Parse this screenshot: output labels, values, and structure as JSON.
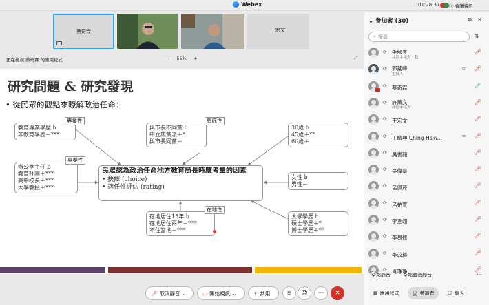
{
  "titlebar": {
    "app_name": "Webex",
    "time": "01:28:37",
    "meeting_info": "會議資訊"
  },
  "video_tiles": [
    {
      "name": "蔡奇霖",
      "type": "avatar"
    },
    {
      "name": "",
      "type": "video"
    },
    {
      "name": "",
      "type": "video"
    },
    {
      "name": "王宏文",
      "type": "avatar"
    }
  ],
  "share_bar": {
    "viewing": "正在檢視 蔡奇霖 的應用程式",
    "zoom_out": "-",
    "zoom": "55%",
    "zoom_in": "+"
  },
  "slide": {
    "title": "研究問題 & 研究發現",
    "bullet": "• 從民眾的觀點來瞭解政治任命：",
    "center": {
      "heading": "民眾認為政治任命地方教育局長時應考量的因素",
      "items": [
        "• 抉擇 (choice)",
        "• 適任性評估 (rating)"
      ]
    },
    "box_expertise": {
      "label": "專業性",
      "lines": [
        "教育專業學歷 b",
        "非教育學歷－***"
      ]
    },
    "box_experience": {
      "label": "專業性",
      "lines": [
        "辦公室主任 b",
        "教育社團＋***",
        "高中校長＋***",
        "大學教授＋***"
      ]
    },
    "box_partisan": {
      "label": "恩庇性",
      "lines": [
        "與市長不同黨 b",
        "中立無黨派＋*",
        "與市長同黨－"
      ]
    },
    "box_age": {
      "lines": [
        "30歲 b",
        "45歲＋**",
        "60歲＋"
      ]
    },
    "box_gender": {
      "lines": [
        "女性 b",
        "男性－"
      ]
    },
    "box_local": {
      "label": "在地性",
      "lines": [
        "在地居住15年 b",
        "在地居住兩年－***",
        "不住當地－***"
      ]
    },
    "box_degree": {
      "lines": [
        "大學學歷 b",
        "碩士學歷＋*",
        "博士學歷＋**"
      ]
    }
  },
  "stripe_colors": [
    "#5a3f68",
    "#7d2f2f",
    "#f2b705"
  ],
  "toolbar": {
    "mute": "取消靜音",
    "video": "開始視訊",
    "share": "共用"
  },
  "panel": {
    "title": "參加者 (30)",
    "search_placeholder": "搜尋",
    "participants": [
      {
        "name": "李郁岑",
        "role": "共同主持人・我",
        "mic": "muted"
      },
      {
        "name": "郭銘峰",
        "role": "主持人",
        "mic": "muted",
        "camera": true,
        "avatar": "photo"
      },
      {
        "name": "蔡奇霖",
        "role": "",
        "mic": "active",
        "presenter": true
      },
      {
        "name": "許薰文",
        "role": "共同主持人",
        "mic": "muted"
      },
      {
        "name": "王宏文",
        "role": "",
        "mic": "muted"
      },
      {
        "name": "王晴興 Ching-Hsin...",
        "role": "",
        "mic": "muted",
        "camera": true
      },
      {
        "name": "吳書毅",
        "role": "",
        "mic": "muted"
      },
      {
        "name": "吳偉寧",
        "role": "",
        "mic": "muted"
      },
      {
        "name": "呂佩芹",
        "role": "",
        "mic": "muted"
      },
      {
        "name": "呂祐萱",
        "role": "",
        "mic": "muted"
      },
      {
        "name": "李丞翊",
        "role": "",
        "mic": "muted"
      },
      {
        "name": "李易修",
        "role": "",
        "mic": "muted"
      },
      {
        "name": "李苡瑄",
        "role": "",
        "mic": "muted"
      },
      {
        "name": "肖琤琤",
        "role": "",
        "mic": "muted"
      }
    ],
    "mute_all": "全部靜音",
    "unmute_all": "全部取消靜音",
    "tabs": [
      "應用程式",
      "參加者",
      "聊天"
    ]
  }
}
